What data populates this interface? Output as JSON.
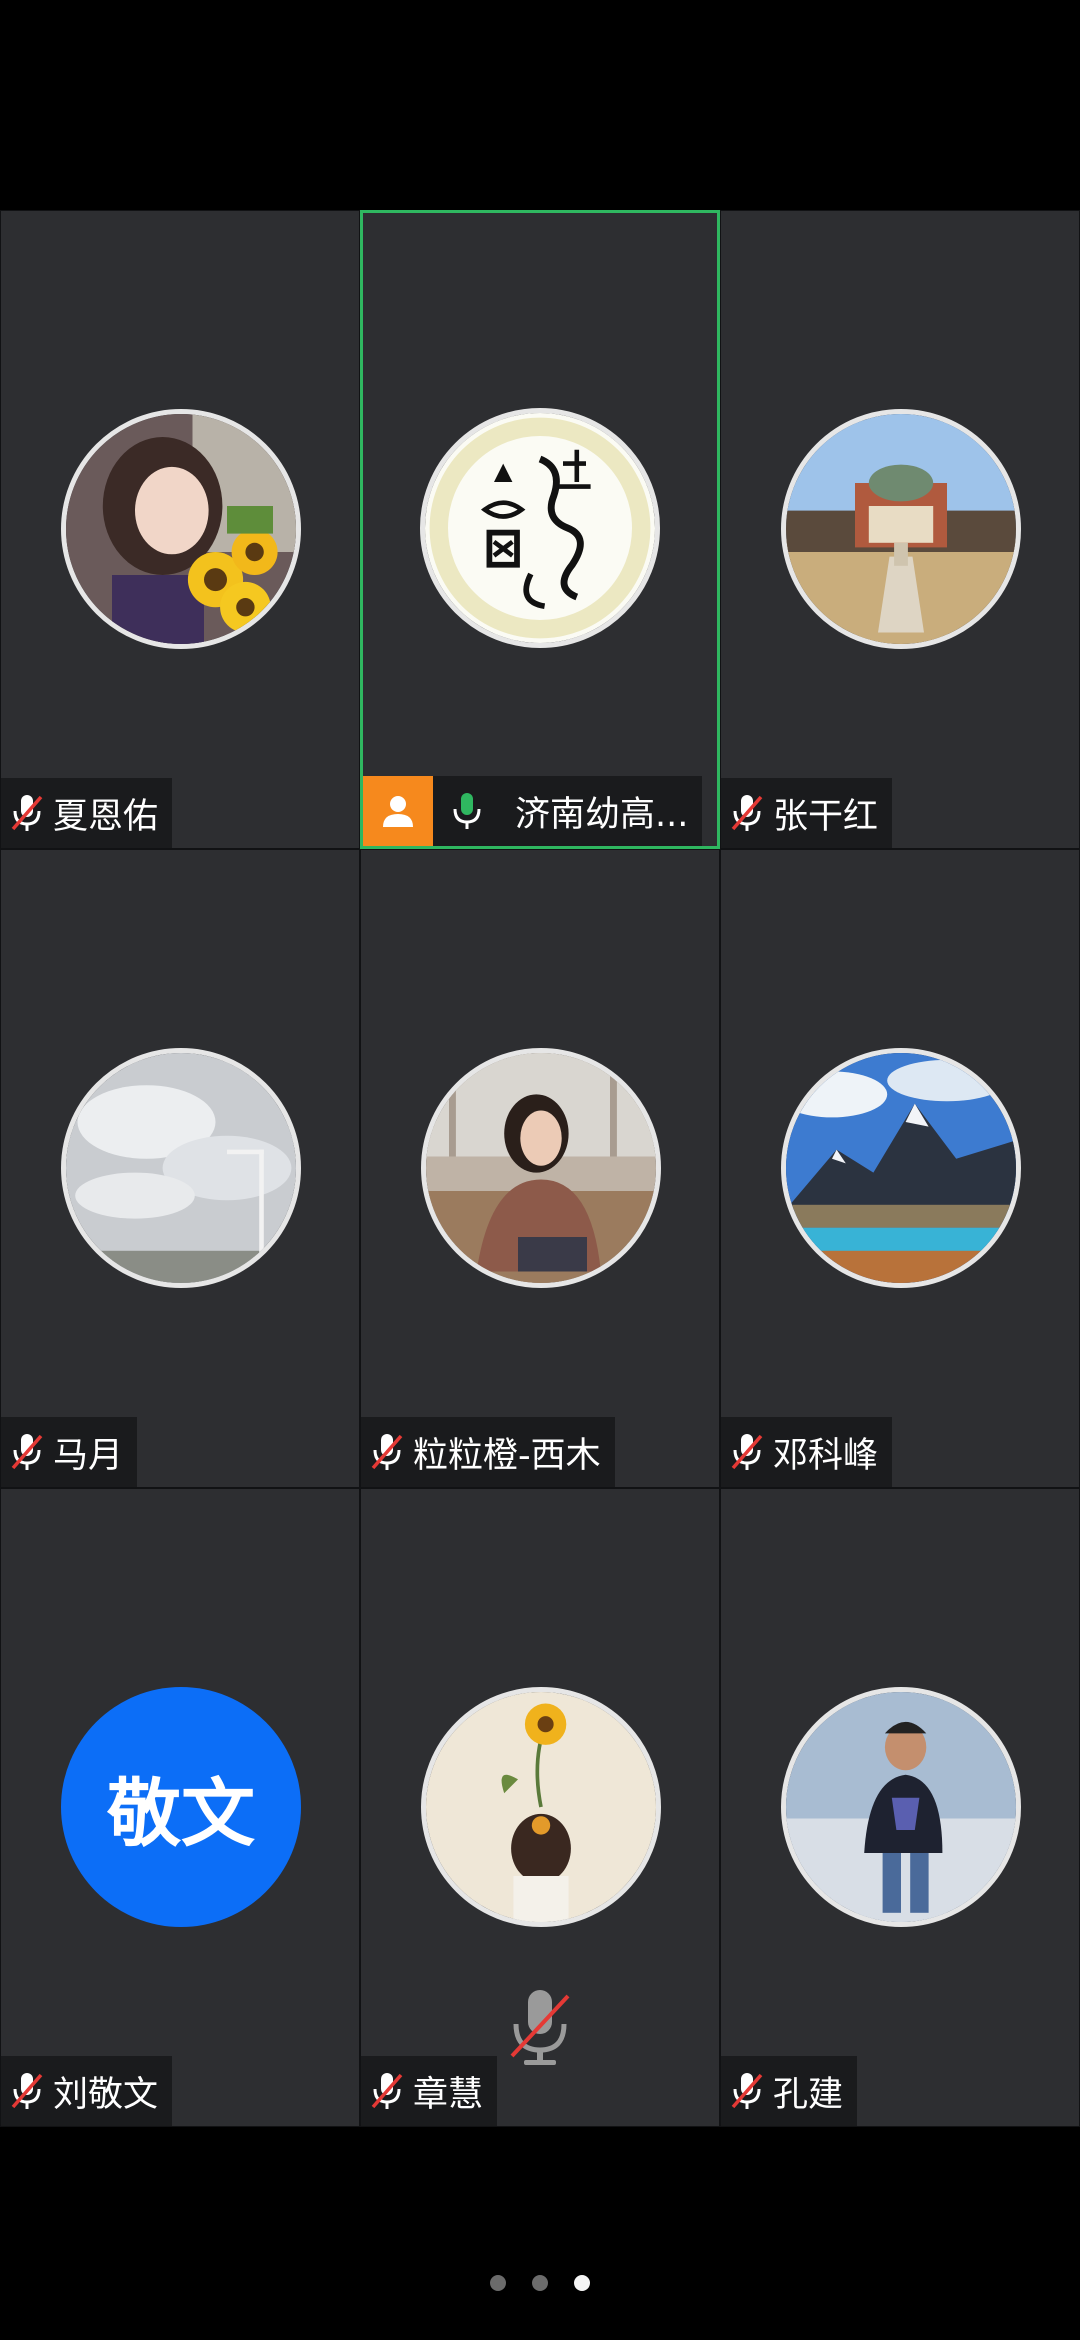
{
  "participants": [
    {
      "name": "夏恩佑",
      "mic": "muted",
      "avatar": "photo-woman-sunflowers"
    },
    {
      "name": "济南幼高...",
      "mic": "on",
      "host": true,
      "avatar": "calligraphy-seal",
      "active": true
    },
    {
      "name": "张干红",
      "mic": "muted",
      "avatar": "photo-campus-building"
    },
    {
      "name": "马月",
      "mic": "muted",
      "avatar": "photo-sky-clouds"
    },
    {
      "name": "粒粒橙-西木",
      "mic": "muted",
      "avatar": "photo-woman-autumn"
    },
    {
      "name": "邓科峰",
      "mic": "muted",
      "avatar": "photo-mountain-lake"
    },
    {
      "name": "刘敬文",
      "mic": "muted",
      "avatar": "initials",
      "initials": "敬文"
    },
    {
      "name": "章慧",
      "mic": "muted",
      "avatar": "illustration-girl-sunflower"
    },
    {
      "name": "孔建",
      "mic": "muted",
      "avatar": "photo-man-standing"
    }
  ],
  "colors": {
    "active_border": "#2fb760",
    "host_badge": "#f6891d",
    "muted_slash": "#e53935",
    "mic_on": "#2fb760",
    "initials_bg": "#0c6ef7"
  },
  "pager": {
    "total": 3,
    "current": 3
  }
}
